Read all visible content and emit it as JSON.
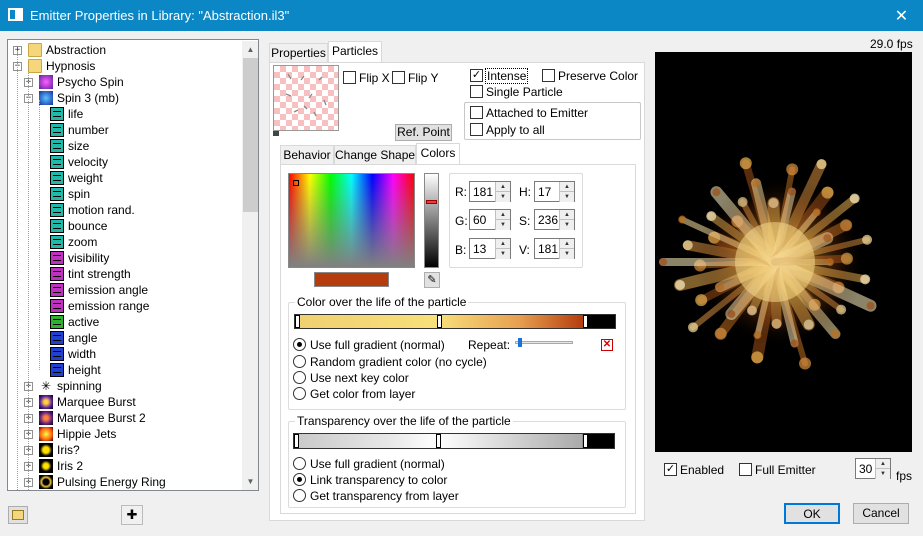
{
  "window": {
    "title": "Emitter Properties in Library: \"Abstraction.il3\"",
    "close_glyph": "✕"
  },
  "tree": {
    "items": [
      {
        "label": "Abstraction",
        "icon": "folder-icon",
        "expander": "+"
      },
      {
        "label": "Hypnosis",
        "icon": "folder-icon",
        "expander": "−"
      },
      {
        "label": "Psycho Spin",
        "icon": "psycho-spin-thumbnail-icon",
        "expander": "+"
      },
      {
        "label": "Spin 3 (mb)",
        "icon": "spin-thumbnail-icon",
        "expander": "−"
      },
      {
        "label": "life",
        "icon": "teal-property-icon"
      },
      {
        "label": "number",
        "icon": "teal-property-icon"
      },
      {
        "label": "size",
        "icon": "teal-property-icon"
      },
      {
        "label": "velocity",
        "icon": "teal-property-icon"
      },
      {
        "label": "weight",
        "icon": "teal-property-icon"
      },
      {
        "label": "spin",
        "icon": "teal-property-icon"
      },
      {
        "label": "motion rand.",
        "icon": "teal-property-icon"
      },
      {
        "label": "bounce",
        "icon": "teal-property-icon"
      },
      {
        "label": "zoom",
        "icon": "teal-property-icon"
      },
      {
        "label": "visibility",
        "icon": "magenta-property-icon"
      },
      {
        "label": "tint strength",
        "icon": "magenta-property-icon"
      },
      {
        "label": "emission angle",
        "icon": "magenta-property-icon"
      },
      {
        "label": "emission range",
        "icon": "magenta-property-icon"
      },
      {
        "label": "active",
        "icon": "green-property-icon"
      },
      {
        "label": "angle",
        "icon": "blue-property-icon"
      },
      {
        "label": "width",
        "icon": "blue-property-icon"
      },
      {
        "label": "height",
        "icon": "blue-property-icon"
      },
      {
        "label": "spinning",
        "icon": "sparkle-icon",
        "expander": "+"
      },
      {
        "label": "Marquee Burst",
        "icon": "marquee-thumbnail-icon",
        "expander": "+"
      },
      {
        "label": "Marquee Burst 2",
        "icon": "marquee2-thumbnail-icon",
        "expander": "+"
      },
      {
        "label": "Hippie Jets",
        "icon": "hippie-thumbnail-icon",
        "expander": "+"
      },
      {
        "label": "Iris?",
        "icon": "iris-thumbnail-icon",
        "expander": "+"
      },
      {
        "label": "Iris 2",
        "icon": "iris2-thumbnail-icon",
        "expander": "+"
      },
      {
        "label": "Pulsing Energy Ring",
        "icon": "ring-thumbnail-icon",
        "expander": "+"
      }
    ]
  },
  "tabs_top": [
    {
      "label": "Properties"
    },
    {
      "label": "Particles"
    }
  ],
  "particles": {
    "flip_x": "Flip X",
    "flip_y": "Flip Y",
    "ref_point": "Ref. Point",
    "intense": "Intense",
    "preserve_color": "Preserve Color",
    "single_particle": "Single Particle",
    "attached_to_emitter": "Attached to Emitter",
    "apply_to_all": "Apply to all"
  },
  "tabs_inner": [
    {
      "label": "Behavior"
    },
    {
      "label": "Change Shape"
    },
    {
      "label": "Colors"
    }
  ],
  "colors": {
    "r_label": "R:",
    "r": "181",
    "g_label": "G:",
    "g": "60",
    "b_label": "B:",
    "b": "13",
    "h_label": "H:",
    "h": "17",
    "s_label": "S:",
    "s": "236",
    "v_label": "V:",
    "v": "181",
    "swatch": "#b53c0d",
    "color_group": "Color over the life of the particle",
    "use_full": "Use full gradient (normal)",
    "random_grad": "Random gradient color (no cycle)",
    "next_key": "Use next key color",
    "from_layer": "Get color from layer",
    "repeat": "Repeat:",
    "trans_group": "Transparency over the life of the particle",
    "t_use_full": "Use full gradient (normal)",
    "t_link": "Link transparency to color",
    "t_from_layer": "Get transparency from layer"
  },
  "preview": {
    "fps": "29.0 fps",
    "enabled": "Enabled",
    "full_emitter": "Full Emitter",
    "fps_value": "30",
    "fps_unit": "fps"
  },
  "buttons": {
    "ok": "OK",
    "cancel": "Cancel"
  }
}
